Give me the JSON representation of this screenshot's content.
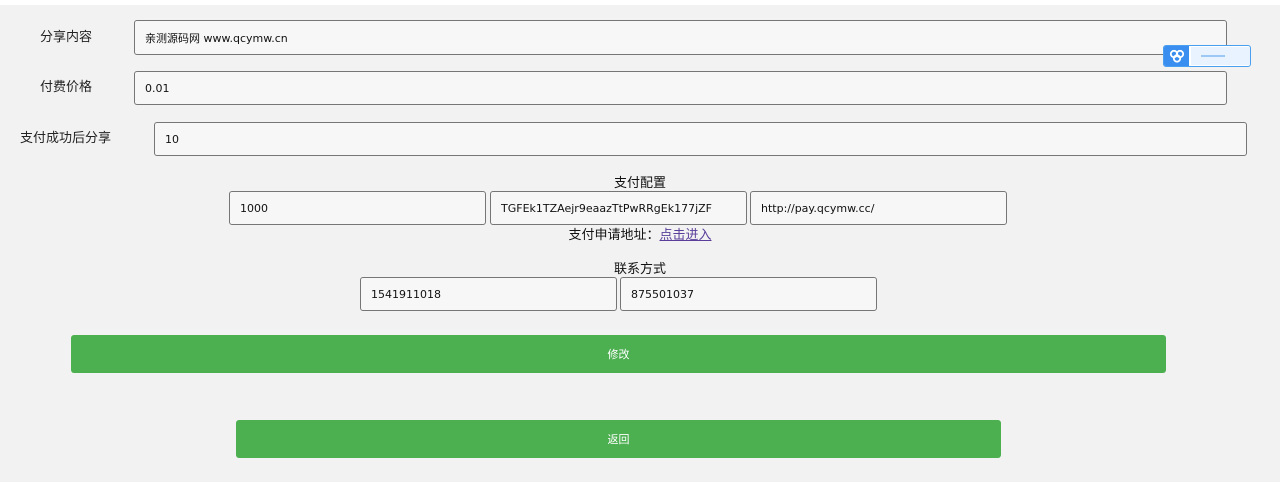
{
  "form": {
    "share_content": {
      "label": "分享内容",
      "value": "亲测源码网 www.qcymw.cn"
    },
    "price": {
      "label": "付费价格",
      "value": "0.01"
    },
    "share_after_pay": {
      "label": "支付成功后分享",
      "value": "10"
    }
  },
  "payment": {
    "title": "支付配置",
    "merchant_id": "1000",
    "merchant_key": "TGFEk1TZAejr9eaazTtPwRRgEk177jZF",
    "api_url": "http://pay.qcymw.cc/",
    "apply_text": "支付申请地址：",
    "apply_link": "点击进入"
  },
  "contact": {
    "title": "联系方式",
    "field1": "1541911018",
    "field2": "875501037"
  },
  "buttons": {
    "modify": "修改",
    "back": "返回"
  },
  "colors": {
    "button_green": "#4caf50",
    "page_background": "#f2f2f2",
    "link": "#5a3e9a",
    "widget_blue": "#3a8ef0"
  },
  "widget": {
    "icon": "cloud-share-icon"
  }
}
